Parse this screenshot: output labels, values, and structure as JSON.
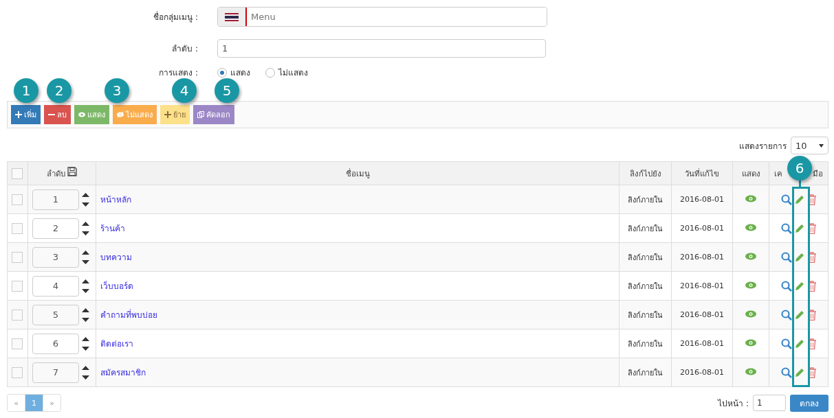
{
  "form": {
    "group_label": "ชื่อกลุ่มเมนู :",
    "group_placeholder": "Menu",
    "order_label": "ลำดับ :",
    "order_value": "1",
    "display_label": "การแสดง :",
    "display_options": [
      {
        "label": "แสดง",
        "selected": true
      },
      {
        "label": "ไม่แสดง",
        "selected": false
      }
    ]
  },
  "toolbar": [
    {
      "kind": "add",
      "label": "เพิ่ม"
    },
    {
      "kind": "delete",
      "label": "ลบ"
    },
    {
      "kind": "show",
      "label": "แสดง"
    },
    {
      "kind": "hide",
      "label": "ไม่แสดง"
    },
    {
      "kind": "move",
      "label": "ย้าย"
    },
    {
      "kind": "copy",
      "label": "คัดลอก"
    }
  ],
  "page_size": {
    "label": "แสดงรายการ",
    "value": "10"
  },
  "table": {
    "all_checked": false,
    "columns": [
      "ลำดับ",
      "ชื่อเมนู",
      "ลิงก์ไปยัง",
      "วันที่แก้ไข",
      "แสดง"
    ],
    "tools_header_parts": [
      "เค",
      "มือ"
    ],
    "rows": [
      {
        "checked": false,
        "order": "1",
        "name": "หน้าหลัก",
        "link": "ลิงก์ภายใน",
        "date": "2016-08-01",
        "visible": true
      },
      {
        "checked": false,
        "order": "2",
        "name": "ร้านค้า",
        "link": "ลิงก์ภายใน",
        "date": "2016-08-01",
        "visible": true
      },
      {
        "checked": false,
        "order": "3",
        "name": "บทความ",
        "link": "ลิงก์ภายใน",
        "date": "2016-08-01",
        "visible": true
      },
      {
        "checked": false,
        "order": "4",
        "name": "เว็บบอร์ด",
        "link": "ลิงก์ภายใน",
        "date": "2016-08-01",
        "visible": true
      },
      {
        "checked": false,
        "order": "5",
        "name": "คำถามที่พบบ่อย",
        "link": "ลิงก์ภายใน",
        "date": "2016-08-01",
        "visible": true
      },
      {
        "checked": false,
        "order": "6",
        "name": "ติดต่อเรา",
        "link": "ลิงก์ภายใน",
        "date": "2016-08-01",
        "visible": true
      },
      {
        "checked": false,
        "order": "7",
        "name": "สมัครสมาชิก",
        "link": "ลิงก์ภายใน",
        "date": "2016-08-01",
        "visible": true
      }
    ]
  },
  "pagination": {
    "prev": "«",
    "pages": [
      {
        "label": "1",
        "selected": true
      }
    ],
    "next": "»",
    "goto_label": "ไปหน้า :",
    "goto_value": "1",
    "go_button": "ตกลง"
  },
  "callouts": [
    "1",
    "2",
    "3",
    "4",
    "5",
    "6"
  ]
}
